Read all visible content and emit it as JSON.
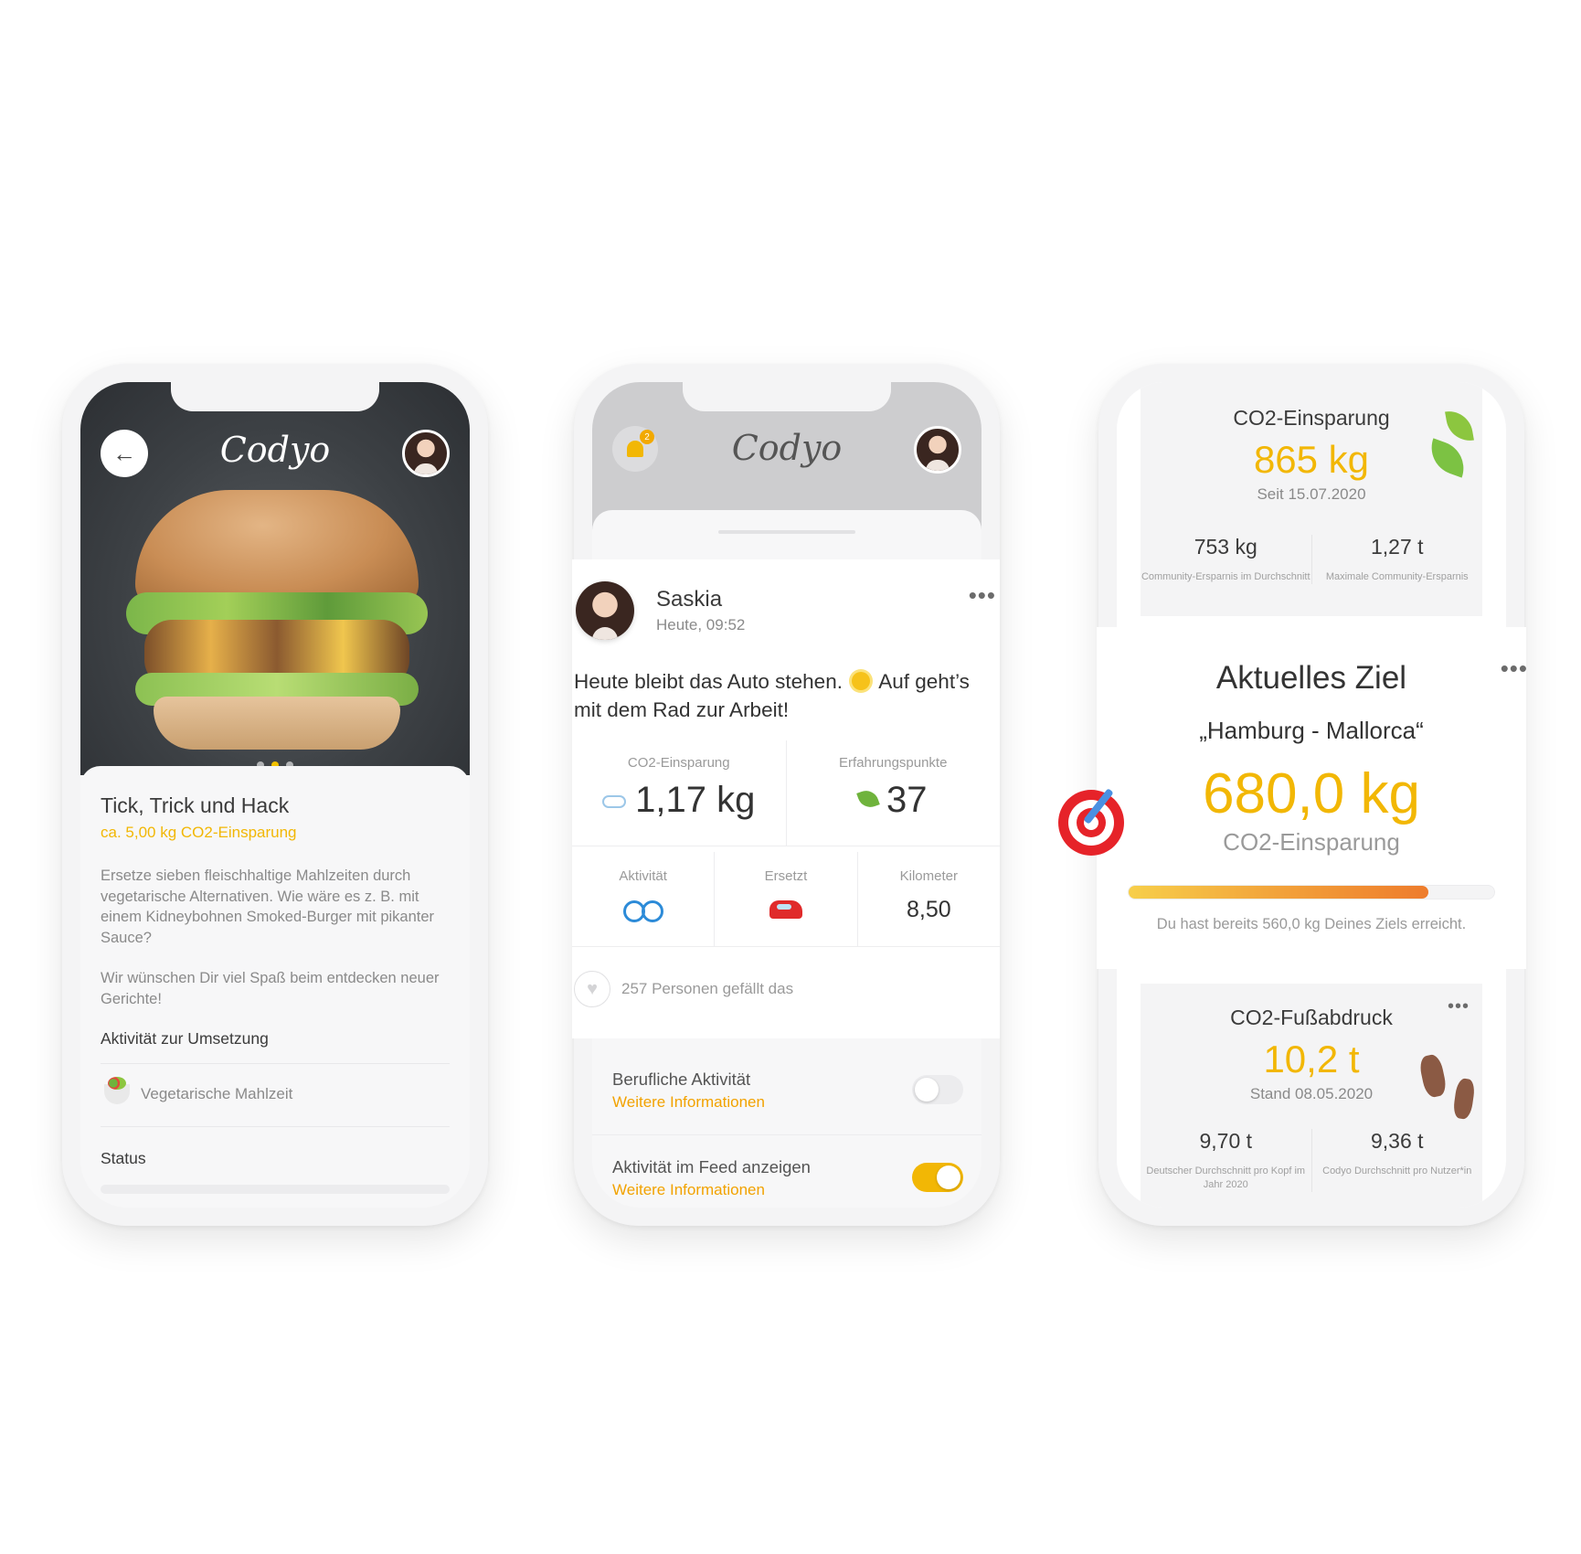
{
  "app": {
    "logo_text": "Codyo"
  },
  "screen1": {
    "back_icon": "arrow-left-icon",
    "title": "Tick, Trick und Hack",
    "saving": "ca. 5,00 kg CO2-Einsparung",
    "description": "Ersetze sieben fleischhaltige Mahlzeiten durch vegetarische Alternativen. Wie wäre es z. B. mit einem Kidneybohnen Smoked-Burger mit pikanter Sauce?",
    "wish": "Wir wünschen Dir viel Spaß beim entdecken neuer Gerichte!",
    "section_label": "Aktivität zur Umsetzung",
    "activity": "Vegetarische Mahlzeit",
    "status_label": "Status",
    "carousel": {
      "count": 3,
      "active": 2
    }
  },
  "screen2": {
    "notification_count": "2",
    "post": {
      "user": "Saskia",
      "time": "Heute, 09:52",
      "text_before": "Heute bleibt das Auto stehen.",
      "text_after": "Auf geht’s mit dem Rad zur Arbeit!",
      "co2_label": "CO2-Einsparung",
      "co2_value": "1,17 kg",
      "xp_label": "Erfahrungspunkte",
      "xp_value": "37",
      "activity_label": "Aktivität",
      "replaced_label": "Ersetzt",
      "km_label": "Kilometer",
      "km_value": "8,50",
      "likes": "257 Personen gefällt das"
    },
    "settings": [
      {
        "title": "Berufliche Aktivität",
        "link": "Weitere Informationen",
        "enabled": false
      },
      {
        "title": "Aktivität im Feed anzeigen",
        "link": "Weitere Informationen",
        "enabled": true
      }
    ]
  },
  "screen3": {
    "savings": {
      "title": "CO2-Einsparung",
      "value": "865 kg",
      "since": "Seit 15.07.2020",
      "left_value": "753 kg",
      "left_label": "Community-Ersparnis im Durchschnitt",
      "right_value": "1,27 t",
      "right_label": "Maximale Community-Ersparnis"
    },
    "goal": {
      "title": "Aktuelles Ziel",
      "name": "„Hamburg - Mallorca“",
      "value": "680,0 kg",
      "label": "CO2-Einsparung",
      "progress": 0.82,
      "note": "Du hast bereits 560,0 kg Deines Ziels erreicht."
    },
    "footprint": {
      "title": "CO2-Fußabdruck",
      "value": "10,2 t",
      "date": "Stand 08.05.2020",
      "left_value": "9,70 t",
      "left_label": "Deutscher Durchschnitt pro Kopf im Jahr 2020",
      "right_value": "9,36 t",
      "right_label": "Codyo Durchschnitt pro Nutzer*in"
    }
  },
  "colors": {
    "accent": "#f2b705",
    "link": "#f2a200",
    "text": "#3b3b3b",
    "muted": "#9a9a9a"
  }
}
